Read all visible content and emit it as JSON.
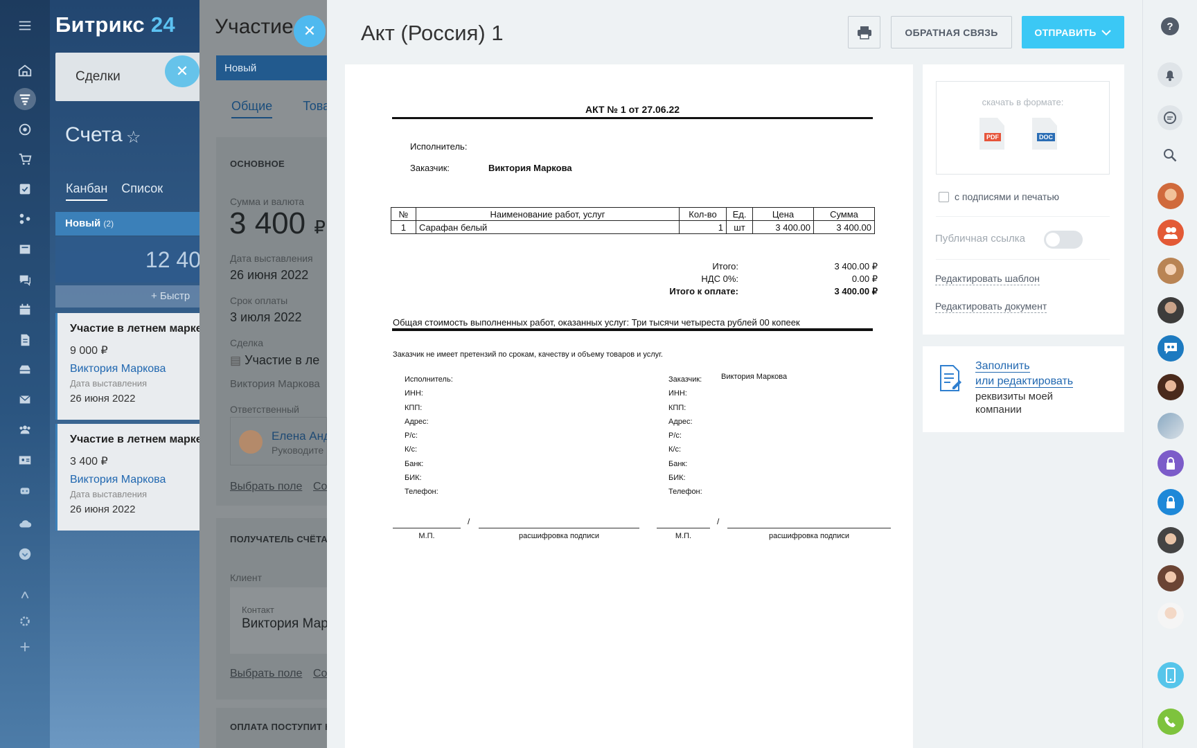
{
  "app": {
    "logo_text": "Битрикс",
    "logo_num": "24"
  },
  "nav": {
    "icons": [
      "menu-icon",
      "home-icon",
      "funnel-icon",
      "target-icon",
      "cart-icon",
      "check-icon",
      "people-flow-icon",
      "newspaper-icon",
      "chat-icon",
      "calendar-icon",
      "document-icon",
      "inbox-icon",
      "mail-icon",
      "group-icon",
      "contact-card-icon",
      "robot-icon",
      "cloud-icon",
      "plus-circle-icon",
      "sitemap-icon",
      "gear-icon",
      "plus-icon"
    ]
  },
  "bg": {
    "deals_label": "Сделки",
    "page_title": "Счета",
    "view_tabs": [
      "Канбан",
      "Список"
    ],
    "column": {
      "name": "Новый",
      "count": "(2)",
      "sum": "12 40"
    },
    "quick_add": "+ Быстр",
    "cards": [
      {
        "title": "Участие в летнем марке",
        "sum": "9 000 ₽",
        "client": "Виктория Маркова",
        "date_label": "Дата выставления",
        "date": "26 июня 2022"
      },
      {
        "title": "Участие в летнем марке",
        "sum": "3 400 ₽",
        "client": "Виктория Маркова",
        "date_label": "Дата выставления",
        "date": "26 июня 2022"
      }
    ]
  },
  "mid": {
    "title": "Участие",
    "stage": "Новый",
    "tabs": [
      "Общие",
      "Това"
    ],
    "section_main": "ОСНОВНОЕ",
    "sum_label": "Сумма и валюта",
    "sum_value": "3 400",
    "sum_currency": "₽",
    "date_label": "Дата выставления",
    "date_value": "26 июня 2022",
    "due_label": "Срок оплаты",
    "due_value": "3 июля 2022",
    "deal_label": "Сделка",
    "deal_value": "Участие в ле",
    "deal_client": "Виктория Маркова",
    "resp_label": "Ответственный",
    "resp_name": "Елена Анд",
    "resp_role": "Руководите",
    "choose_field": "Выбрать поле",
    "create_field": "Со",
    "section_recipient": "ПОЛУЧАТЕЛЬ СЧЁТА",
    "client_label": "Клиент",
    "contact_label": "Контакт",
    "contact_value": "Виктория Мар",
    "section_payment": "ОПЛАТА ПОСТУПИТ Н"
  },
  "main": {
    "title": "Акт (Россия) 1",
    "feedback": "ОБРАТНАЯ СВЯЗЬ",
    "send": "ОТПРАВИТЬ"
  },
  "doc": {
    "heading": "АКТ № 1 от 27.06.22",
    "executor_label": "Исполнитель:",
    "customer_label": "Заказчик:",
    "customer_name": "Виктория Маркова",
    "table_headers": [
      "№",
      "Наименование работ, услуг",
      "Кол-во",
      "Ед.",
      "Цена",
      "Сумма"
    ],
    "rows": [
      [
        "1",
        "Сарафан белый",
        "1",
        "шт",
        "3 400.00",
        "3 400.00"
      ]
    ],
    "total_label": "Итого:",
    "total_value": "3 400.00 ₽",
    "vat_label": "НДС 0%:",
    "vat_value": "0.00 ₽",
    "pay_label": "Итого к оплате:",
    "pay_value": "3 400.00 ₽",
    "summary": "Общая стоимость выполненных работ, оказанных услуг: Три тысячи четыреста рублей 00 копеек",
    "claims": "Заказчик не имеет претензий по срокам, качеству и объему товаров и услуг.",
    "left_req": [
      "Исполнитель:",
      "ИНН:",
      "КПП:",
      "Адрес:",
      "Р/с:",
      "К/с:",
      "Банк:",
      "БИК:",
      "Телефон:"
    ],
    "right_req": [
      "Заказчик:",
      "ИНН:",
      "КПП:",
      "Адрес:",
      "Р/с:",
      "К/с:",
      "Банк:",
      "БИК:",
      "Телефон:"
    ],
    "right_customer": "Виктория Маркова",
    "sign_slash": "/",
    "mp": "М.П.",
    "sign_decode": "расшифровка подписи"
  },
  "side": {
    "download_label": "скачать в формате:",
    "pdf": "PDF",
    "doc": "DOC",
    "sign_checkbox": "с подписями и печатью",
    "public_link": "Публичная ссылка",
    "edit_template": "Редактировать шаблон",
    "edit_document": "Редактировать документ",
    "fill_link_1": "Заполнить",
    "fill_link_2": "или редактировать",
    "fill_text": "реквизиты моей компании"
  },
  "colors": {
    "accent": "#3bc8f5",
    "link": "#2067b0",
    "nav_bg": "#1d3b5e"
  }
}
